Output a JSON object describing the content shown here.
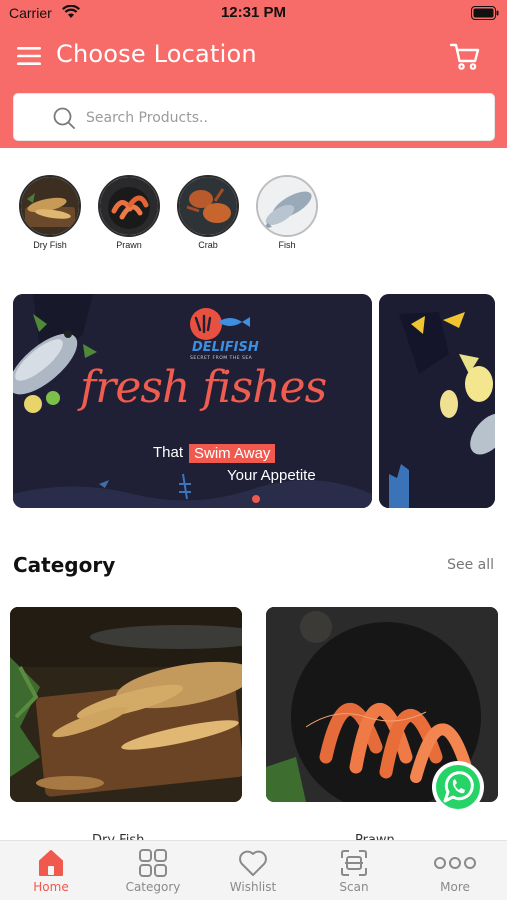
{
  "status_bar": {
    "carrier": "Carrier",
    "time": "12:31 PM"
  },
  "header": {
    "title": "Choose Location",
    "background_color": "#f76b68",
    "icons": [
      "menu-icon",
      "cart-icon"
    ]
  },
  "search": {
    "placeholder": "Search Products..",
    "value": ""
  },
  "quick_categories": [
    {
      "label": "Dry Fish",
      "icon": "dry-fish-image"
    },
    {
      "label": "Prawn",
      "icon": "prawn-image"
    },
    {
      "label": "Crab",
      "icon": "crab-image"
    },
    {
      "label": "Fish",
      "icon": "fish-image"
    }
  ],
  "banner": {
    "brand": "DELIFISH",
    "tagline": "SECRET FROM THE SEA",
    "headline": "fresh fishes",
    "line_that": "That",
    "line_swim": "Swim Away",
    "line_appetite": "Your Appetite",
    "accent_color": "#f0594d",
    "background_color": "#1f2036",
    "slide_count": 1,
    "active_slide": 1
  },
  "category_section": {
    "title": "Category",
    "see_all": "See all",
    "cards": [
      {
        "label": "Dry Fish",
        "image": "dry-fish-photo"
      },
      {
        "label": "Prawn",
        "image": "prawn-photo"
      }
    ]
  },
  "tabbar": {
    "active_color": "#f0594d",
    "tabs": [
      {
        "label": "Home",
        "icon": "home-icon",
        "active": true
      },
      {
        "label": "Category",
        "icon": "grid-icon",
        "active": false
      },
      {
        "label": "Wishlist",
        "icon": "heart-icon",
        "active": false
      },
      {
        "label": "Scan",
        "icon": "scan-icon",
        "active": false
      },
      {
        "label": "More",
        "icon": "more-icon",
        "active": false
      }
    ]
  }
}
